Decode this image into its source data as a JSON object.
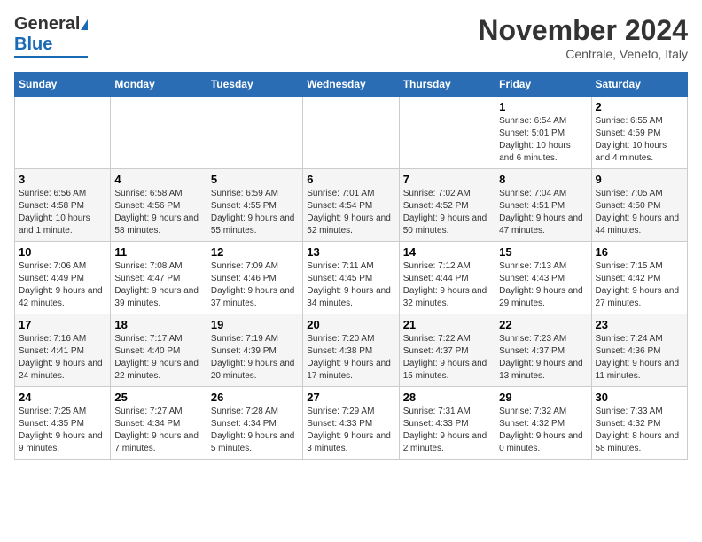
{
  "header": {
    "logo_general": "General",
    "logo_blue": "Blue",
    "month_title": "November 2024",
    "subtitle": "Centrale, Veneto, Italy"
  },
  "calendar": {
    "weekdays": [
      "Sunday",
      "Monday",
      "Tuesday",
      "Wednesday",
      "Thursday",
      "Friday",
      "Saturday"
    ],
    "weeks": [
      [
        {
          "day": "",
          "info": ""
        },
        {
          "day": "",
          "info": ""
        },
        {
          "day": "",
          "info": ""
        },
        {
          "day": "",
          "info": ""
        },
        {
          "day": "",
          "info": ""
        },
        {
          "day": "1",
          "info": "Sunrise: 6:54 AM\nSunset: 5:01 PM\nDaylight: 10 hours and 6 minutes."
        },
        {
          "day": "2",
          "info": "Sunrise: 6:55 AM\nSunset: 4:59 PM\nDaylight: 10 hours and 4 minutes."
        }
      ],
      [
        {
          "day": "3",
          "info": "Sunrise: 6:56 AM\nSunset: 4:58 PM\nDaylight: 10 hours and 1 minute."
        },
        {
          "day": "4",
          "info": "Sunrise: 6:58 AM\nSunset: 4:56 PM\nDaylight: 9 hours and 58 minutes."
        },
        {
          "day": "5",
          "info": "Sunrise: 6:59 AM\nSunset: 4:55 PM\nDaylight: 9 hours and 55 minutes."
        },
        {
          "day": "6",
          "info": "Sunrise: 7:01 AM\nSunset: 4:54 PM\nDaylight: 9 hours and 52 minutes."
        },
        {
          "day": "7",
          "info": "Sunrise: 7:02 AM\nSunset: 4:52 PM\nDaylight: 9 hours and 50 minutes."
        },
        {
          "day": "8",
          "info": "Sunrise: 7:04 AM\nSunset: 4:51 PM\nDaylight: 9 hours and 47 minutes."
        },
        {
          "day": "9",
          "info": "Sunrise: 7:05 AM\nSunset: 4:50 PM\nDaylight: 9 hours and 44 minutes."
        }
      ],
      [
        {
          "day": "10",
          "info": "Sunrise: 7:06 AM\nSunset: 4:49 PM\nDaylight: 9 hours and 42 minutes."
        },
        {
          "day": "11",
          "info": "Sunrise: 7:08 AM\nSunset: 4:47 PM\nDaylight: 9 hours and 39 minutes."
        },
        {
          "day": "12",
          "info": "Sunrise: 7:09 AM\nSunset: 4:46 PM\nDaylight: 9 hours and 37 minutes."
        },
        {
          "day": "13",
          "info": "Sunrise: 7:11 AM\nSunset: 4:45 PM\nDaylight: 9 hours and 34 minutes."
        },
        {
          "day": "14",
          "info": "Sunrise: 7:12 AM\nSunset: 4:44 PM\nDaylight: 9 hours and 32 minutes."
        },
        {
          "day": "15",
          "info": "Sunrise: 7:13 AM\nSunset: 4:43 PM\nDaylight: 9 hours and 29 minutes."
        },
        {
          "day": "16",
          "info": "Sunrise: 7:15 AM\nSunset: 4:42 PM\nDaylight: 9 hours and 27 minutes."
        }
      ],
      [
        {
          "day": "17",
          "info": "Sunrise: 7:16 AM\nSunset: 4:41 PM\nDaylight: 9 hours and 24 minutes."
        },
        {
          "day": "18",
          "info": "Sunrise: 7:17 AM\nSunset: 4:40 PM\nDaylight: 9 hours and 22 minutes."
        },
        {
          "day": "19",
          "info": "Sunrise: 7:19 AM\nSunset: 4:39 PM\nDaylight: 9 hours and 20 minutes."
        },
        {
          "day": "20",
          "info": "Sunrise: 7:20 AM\nSunset: 4:38 PM\nDaylight: 9 hours and 17 minutes."
        },
        {
          "day": "21",
          "info": "Sunrise: 7:22 AM\nSunset: 4:37 PM\nDaylight: 9 hours and 15 minutes."
        },
        {
          "day": "22",
          "info": "Sunrise: 7:23 AM\nSunset: 4:37 PM\nDaylight: 9 hours and 13 minutes."
        },
        {
          "day": "23",
          "info": "Sunrise: 7:24 AM\nSunset: 4:36 PM\nDaylight: 9 hours and 11 minutes."
        }
      ],
      [
        {
          "day": "24",
          "info": "Sunrise: 7:25 AM\nSunset: 4:35 PM\nDaylight: 9 hours and 9 minutes."
        },
        {
          "day": "25",
          "info": "Sunrise: 7:27 AM\nSunset: 4:34 PM\nDaylight: 9 hours and 7 minutes."
        },
        {
          "day": "26",
          "info": "Sunrise: 7:28 AM\nSunset: 4:34 PM\nDaylight: 9 hours and 5 minutes."
        },
        {
          "day": "27",
          "info": "Sunrise: 7:29 AM\nSunset: 4:33 PM\nDaylight: 9 hours and 3 minutes."
        },
        {
          "day": "28",
          "info": "Sunrise: 7:31 AM\nSunset: 4:33 PM\nDaylight: 9 hours and 2 minutes."
        },
        {
          "day": "29",
          "info": "Sunrise: 7:32 AM\nSunset: 4:32 PM\nDaylight: 9 hours and 0 minutes."
        },
        {
          "day": "30",
          "info": "Sunrise: 7:33 AM\nSunset: 4:32 PM\nDaylight: 8 hours and 58 minutes."
        }
      ]
    ]
  }
}
